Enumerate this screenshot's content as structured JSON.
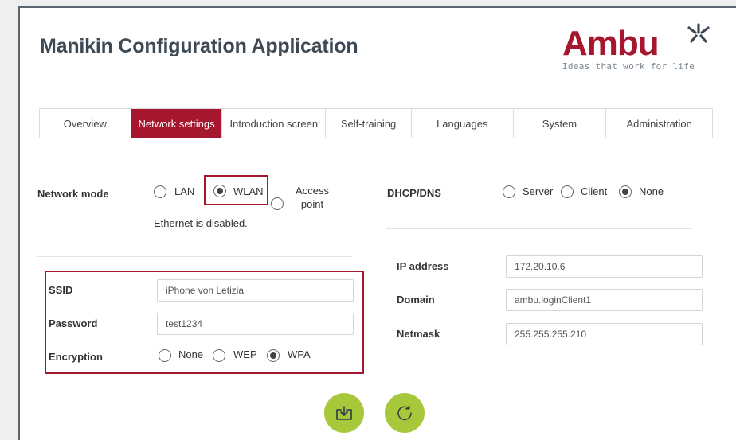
{
  "app": {
    "title": "Manikin Configuration Application"
  },
  "logo": {
    "word": "Ambu",
    "tagline": "Ideas that work for life"
  },
  "tabs": [
    {
      "label": "Overview",
      "active": false
    },
    {
      "label": "Network settings",
      "active": true
    },
    {
      "label": "Introduction screen",
      "active": false
    },
    {
      "label": "Self-training",
      "active": false
    },
    {
      "label": "Languages",
      "active": false
    },
    {
      "label": "System",
      "active": false
    },
    {
      "label": "Administration",
      "active": false
    }
  ],
  "network_mode": {
    "label": "Network mode",
    "options": [
      "LAN",
      "WLAN",
      "Access point"
    ],
    "selected": "WLAN",
    "status": "Ethernet is disabled."
  },
  "dhcp": {
    "label": "DHCP/DNS",
    "options": [
      "Server",
      "Client",
      "None"
    ],
    "selected": "None"
  },
  "wifi": {
    "ssid_label": "SSID",
    "ssid_value": "iPhone von Letizia",
    "password_label": "Password",
    "password_value": "test1234",
    "encryption_label": "Encryption",
    "encryption_options": [
      "None",
      "WEP",
      "WPA"
    ],
    "encryption_selected": "WPA"
  },
  "ip": {
    "ip_label": "IP address",
    "ip_value": "172.20.10.6",
    "domain_label": "Domain",
    "domain_value": "ambu.loginClient1",
    "netmask_label": "Netmask",
    "netmask_value": "255.255.255.210"
  },
  "actions": {
    "save_icon": "download-tray-icon",
    "reset_icon": "refresh-icon"
  },
  "colors": {
    "accent": "#a6162f",
    "button": "#a8c83c",
    "title": "#3d4a55"
  }
}
